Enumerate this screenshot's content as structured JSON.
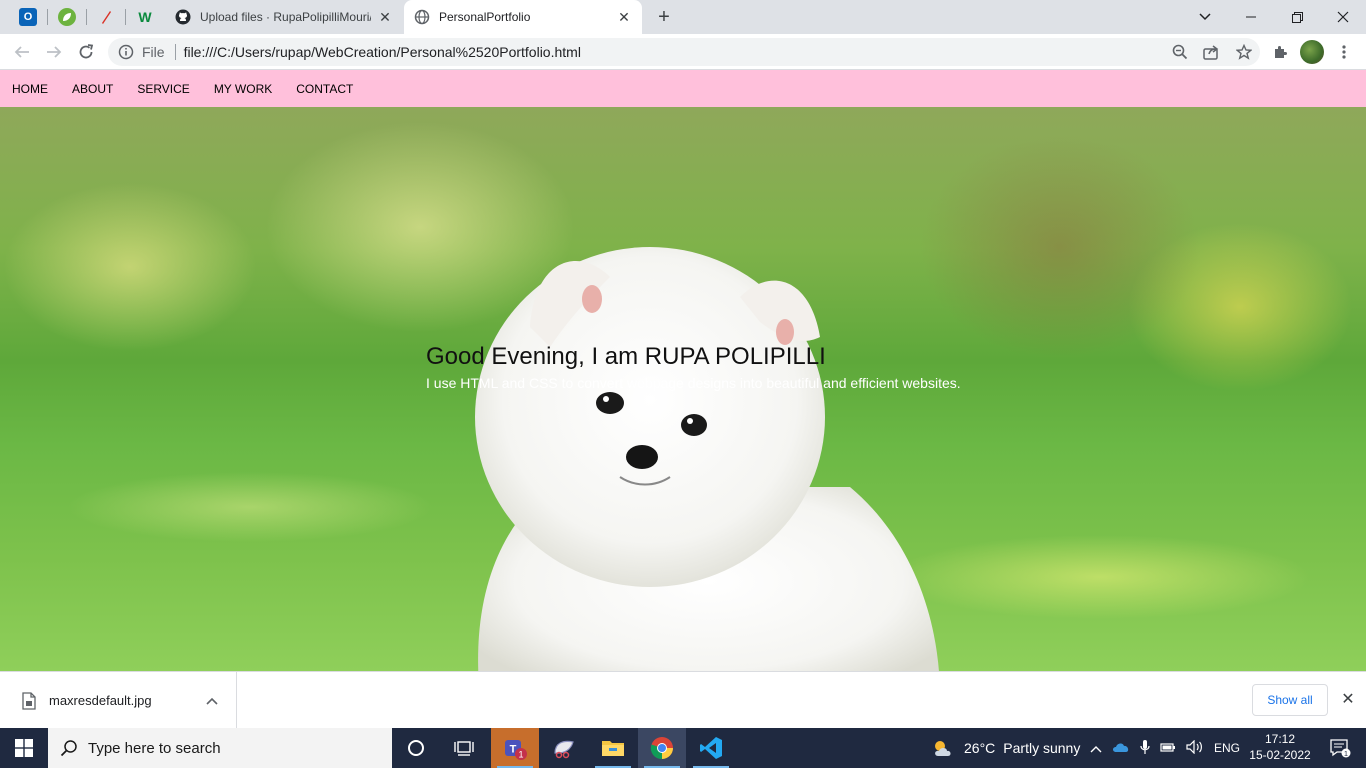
{
  "browser": {
    "tabs": [
      {
        "title": "Upload files · RupaPolipilliMouri/",
        "active": false
      },
      {
        "title": "PersonalPortfolio",
        "active": true
      }
    ],
    "address": {
      "scheme_label": "File",
      "url": "file:///C:/Users/rupap/WebCreation/Personal%2520Portfolio.html"
    }
  },
  "site": {
    "nav": [
      "HOME",
      "ABOUT",
      "SERVICE",
      "MY WORK",
      "CONTACT"
    ],
    "hero": {
      "title": "Good Evening, I am RUPA POLIPILLI",
      "subtitle": "I use HTML and CSS to convert webpage designs into beautiful and efficient websites."
    }
  },
  "downloads": {
    "file_name": "maxresdefault.jpg",
    "show_all": "Show all"
  },
  "taskbar": {
    "search_placeholder": "Type here to search",
    "teams_badge": "1",
    "weather": {
      "temp": "26°C",
      "condition": "Partly sunny"
    },
    "language": "ENG",
    "time": "17:12",
    "date": "15-02-2022",
    "notification_count": "1"
  },
  "colors": {
    "nav_bg": "#ffc0db",
    "taskbar_bg": "#1f2940",
    "accent_blue": "#1a73e8"
  }
}
